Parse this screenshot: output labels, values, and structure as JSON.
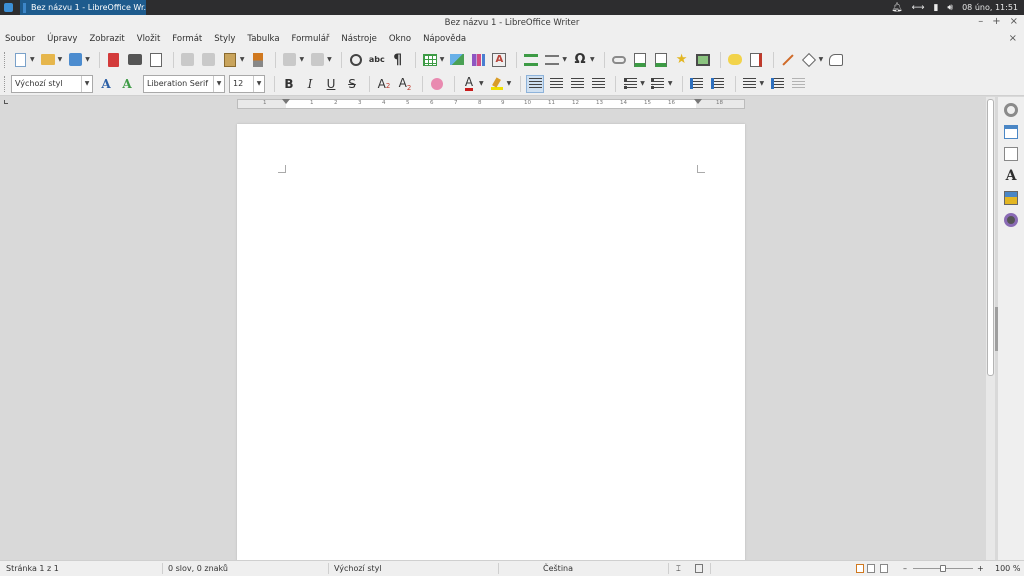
{
  "panel": {
    "task_label": "Bez názvu 1 - LibreOffice Wr...",
    "datetime": "08 úno, 11:51",
    "tray_icons": [
      "bell-icon",
      "network-icon",
      "battery-icon",
      "volume-icon"
    ]
  },
  "window": {
    "title": "Bez názvu 1 - LibreOffice Writer",
    "minimize": "–",
    "maximize": "+",
    "close": "×"
  },
  "menubar": {
    "items": [
      "Soubor",
      "Úpravy",
      "Zobrazit",
      "Vložit",
      "Formát",
      "Styly",
      "Tabulka",
      "Formulář",
      "Nástroje",
      "Okno",
      "Nápověda"
    ],
    "close_document": "×"
  },
  "formatting": {
    "paragraph_style": "Výchozí styl",
    "font_name": "Liberation Serif",
    "font_size": "12",
    "bold": "B",
    "italic": "I",
    "underline": "U",
    "strikethrough": "S",
    "superscript": "A",
    "subscript": "A",
    "font_color": "A",
    "colors": {
      "font_color": "#c81b1b",
      "highlight": "#f0e000",
      "accent": "#2e6fbd"
    }
  },
  "toolbar_standard": {
    "spelling_label": "abc",
    "formatting_marks": "¶",
    "special_char": "Ω"
  },
  "ruler": {
    "ticks": [
      "1",
      "1",
      "2",
      "3",
      "4",
      "5",
      "6",
      "7",
      "8",
      "9",
      "10",
      "11",
      "12",
      "13",
      "14",
      "15",
      "16",
      "18"
    ]
  },
  "statusbar": {
    "page": "Stránka 1 z 1",
    "words": "0 slov, 0 znaků",
    "style": "Výchozí styl",
    "language": "Čeština",
    "zoom": "100 %",
    "zoom_fraction": 0.5
  },
  "sidebar": {
    "icons": [
      "gear-icon",
      "properties-icon",
      "page-icon",
      "styles-icon",
      "gallery-icon",
      "navigator-icon"
    ]
  }
}
